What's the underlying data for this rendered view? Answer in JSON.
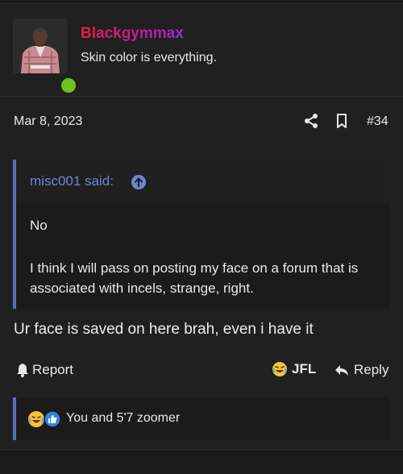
{
  "post": {
    "username": "Blackgymmax",
    "user_title": "Skin color is everything.",
    "date": "Mar 8, 2023",
    "post_number": "#34",
    "body": "Ur face is saved on here brah, even i have it"
  },
  "quote": {
    "author": "misc001 said:",
    "line1": "No",
    "line2": "I think I will pass on posting my face on a forum that is associated with incels, strange, right."
  },
  "actions": {
    "report": "Report",
    "reaction": "JFL",
    "reply": "Reply"
  },
  "reactions": {
    "users": "You and 5'7 zoomer"
  },
  "colors": {
    "quote_accent": "#5a6fb8",
    "online": "#6fc21b",
    "link_blue": "#6e85d3"
  },
  "icons": [
    "share-icon",
    "bookmark-icon",
    "arrow-up-circle-icon",
    "bell-icon",
    "laughing-emoji-icon",
    "reply-arrow-icon",
    "like-icon"
  ]
}
